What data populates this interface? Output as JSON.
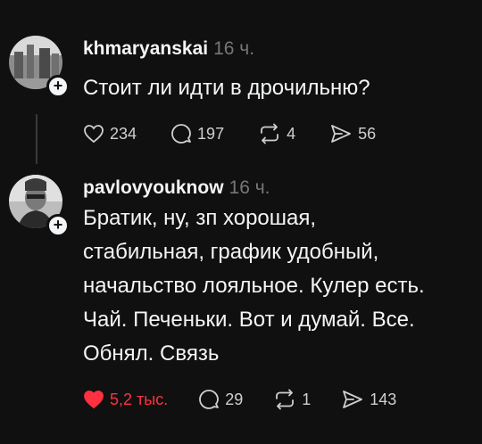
{
  "posts": [
    {
      "username": "khmaryanskai",
      "time": "16 ч.",
      "text": "Стоит ли идти в дрочильню?",
      "likes": "234",
      "replies": "197",
      "reposts": "4",
      "shares": "56",
      "liked": false
    },
    {
      "username": "pavlovyouknow",
      "time": "16 ч.",
      "text_lines": [
        "Братик, ну, зп хорошая,",
        "стабильная, график удобный,",
        "начальство лояльное. Кулер есть.",
        "Чай. Печеньки. Вот и думай. Все.",
        "Обнял. Связь"
      ],
      "likes": "5,2 тыс.",
      "replies": "29",
      "reposts": "1",
      "shares": "143",
      "liked": true
    }
  ],
  "colors": {
    "like_active": "#ff3040",
    "background": "#101010",
    "muted": "#777777"
  }
}
